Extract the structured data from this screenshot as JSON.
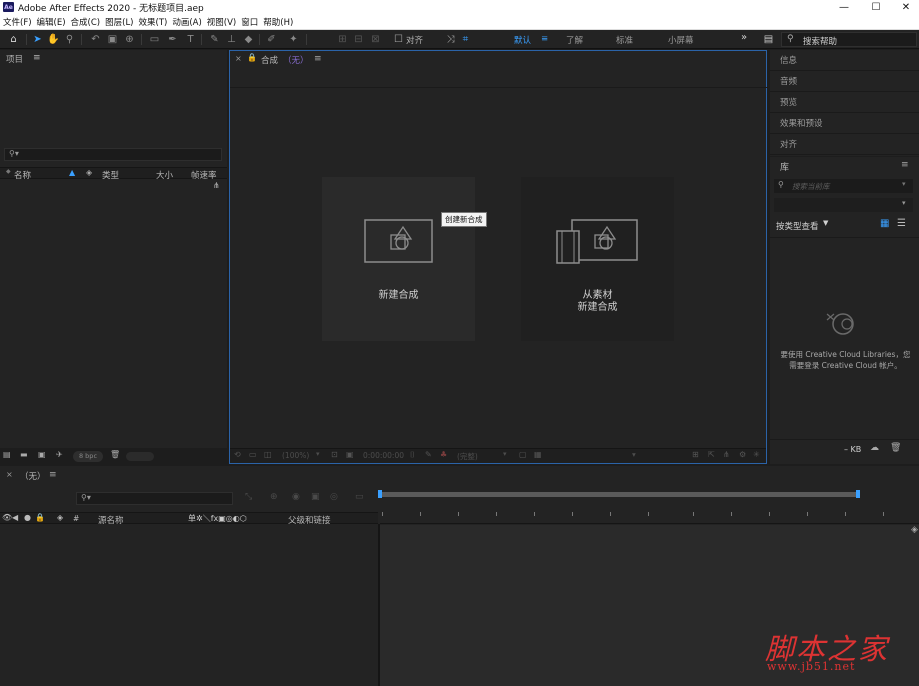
{
  "window": {
    "title": "Adobe After Effects 2020 - 无标题项目.aep",
    "logo": "Ae",
    "minimize_icon": "—",
    "maximize_icon": "☐",
    "close_icon": "✕"
  },
  "menu": [
    "文件(F)",
    "编辑(E)",
    "合成(C)",
    "图层(L)",
    "效果(T)",
    "动画(A)",
    "视图(V)",
    "窗口",
    "帮助(H)"
  ],
  "toolbar": {
    "snap_label": "对齐",
    "workspaces": [
      "默认",
      "了解",
      "标准",
      "小屏幕"
    ],
    "search_help": "搜索帮助"
  },
  "project": {
    "title": "项目",
    "menu_icon": "≡",
    "columns": [
      "名称",
      "类型",
      "大小",
      "帧速率"
    ],
    "bpc": "8 bpc"
  },
  "composition": {
    "tab_label": "合成",
    "tab_state": "（无）",
    "new_comp_label": "新建合成",
    "from_footage_line1": "从素材",
    "from_footage_line2": "新建合成",
    "tooltip": "创建新合成",
    "zoom": "(100%)",
    "timecode": "0:00:00:00",
    "resolution": "(完整)"
  },
  "right_panels": [
    "信息",
    "音频",
    "预览",
    "效果和预设",
    "对齐"
  ],
  "libraries": {
    "title": "库",
    "search_placeholder": "搜索当前库",
    "view_by": "按类型查看",
    "signin_line1": "要使用 Creative Cloud Libraries，您",
    "signin_line2": "需要登录 Creative Cloud 帐户。",
    "storage": "– KB"
  },
  "timeline": {
    "tab_label": "（无）",
    "menu_icon": "≡",
    "col_source": "源名称",
    "col_parent": "父级和链接",
    "switch_icons": "单✲＼fx▣◎◐⬡"
  },
  "watermark": {
    "main": "脚本之家",
    "url": "www.jb51.net"
  }
}
